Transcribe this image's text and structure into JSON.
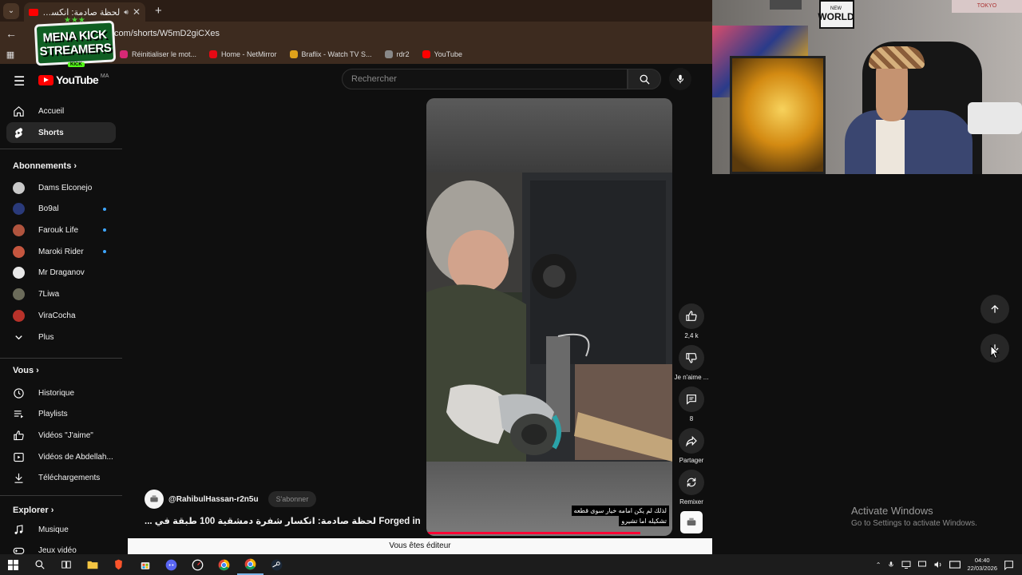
{
  "browser": {
    "tab_title": "لحظة صادمة: انكسار شفرة د...",
    "url": "com/shorts/W5mD2giCXes",
    "bookmarks": [
      {
        "label": "Réinitialiser le mot...",
        "color": "#d62976"
      },
      {
        "label": "Home - NetMirror",
        "color": "#e50914"
      },
      {
        "label": "Braflix - Watch TV S...",
        "color": "#e0a21a"
      },
      {
        "label": "rdr2",
        "color": "#888888"
      },
      {
        "label": "YouTube",
        "color": "#ff0000"
      }
    ]
  },
  "overlay_logo": {
    "line1": "MENA KICK",
    "line2": "STREAMERS"
  },
  "youtube": {
    "logo_text": "YouTube",
    "country_code": "MA",
    "search_placeholder": "Rechercher",
    "nav_main": [
      {
        "label": "Accueil",
        "icon": "home-icon"
      },
      {
        "label": "Shorts",
        "icon": "shorts-icon",
        "active": true
      }
    ],
    "subscriptions_title": "Abonnements",
    "subscriptions": [
      {
        "label": "Dams Elconejo",
        "color": "#c9c9c9",
        "new": false
      },
      {
        "label": "Bo9al",
        "color": "#2a3a7a",
        "new": true
      },
      {
        "label": "Farouk Life",
        "color": "#b0543e",
        "new": true
      },
      {
        "label": "Maroki Rider",
        "color": "#c5563f",
        "new": true
      },
      {
        "label": "Mr Draganov",
        "color": "#e8e8e8",
        "new": false
      },
      {
        "label": "7Liwa",
        "color": "#6b6b5a",
        "new": false
      },
      {
        "label": "ViraCocha",
        "color": "#b8322a",
        "new": false
      }
    ],
    "more_label": "Plus",
    "you_title": "Vous",
    "you_items": [
      {
        "label": "Historique",
        "icon": "history-icon"
      },
      {
        "label": "Playlists",
        "icon": "playlist-icon"
      },
      {
        "label": "Vidéos \"J'aime\"",
        "icon": "like-icon"
      },
      {
        "label": "Vidéos de Abdellah...",
        "icon": "video-icon"
      },
      {
        "label": "Téléchargements",
        "icon": "download-icon"
      }
    ],
    "explore_title": "Explorer",
    "explore_items": [
      {
        "label": "Musique",
        "icon": "music-icon"
      },
      {
        "label": "Jeux vidéo",
        "icon": "gamepad-icon"
      }
    ],
    "short": {
      "caption_line1": "لذلك لم يكن امامه خيار سوى قطعه",
      "caption_line2": "تشكيله اما تشيرو",
      "channel": "@RahibulHassan-r2n5u",
      "subscribe_label": "S'abonner",
      "title": "... لحظة صادمة: انكسار شفرة دمشقية 100 طبقة في Forged in",
      "progress": 0.87
    },
    "actions": {
      "likes": "2,4 k",
      "dislike_label": "Je n'aime ...",
      "comments": "8",
      "share_label": "Partager",
      "remix_label": "Remixer"
    },
    "editor_banner": "Vous êtes éditeur"
  },
  "webcam": {
    "sign_small": "NEW",
    "sign_big": "WORLD",
    "top_right_text": "TOKYO"
  },
  "windows_watermark": {
    "title": "Activate Windows",
    "subtitle": "Go to Settings to activate Windows."
  },
  "taskbar": {
    "time": "04:40",
    "date": "22/03/2026"
  }
}
